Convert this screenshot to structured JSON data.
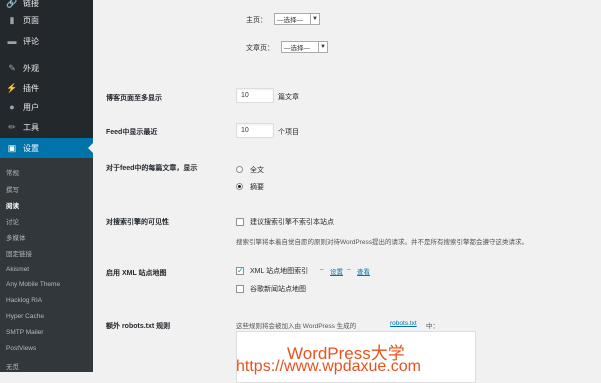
{
  "sidebar": {
    "menu": [
      {
        "icon": "link-icon",
        "glyph": "🔗",
        "label": "链接"
      },
      {
        "icon": "page-icon",
        "glyph": "▮",
        "label": "页面"
      },
      {
        "icon": "comment-icon",
        "glyph": "▬",
        "label": "评论"
      },
      {
        "icon": "appearance-icon",
        "glyph": "✎",
        "label": "外观"
      },
      {
        "icon": "plugin-icon",
        "glyph": "⚡",
        "label": "插件"
      },
      {
        "icon": "user-icon",
        "glyph": "●",
        "label": "用户"
      },
      {
        "icon": "tools-icon",
        "glyph": "✏",
        "label": "工具"
      }
    ],
    "current": {
      "icon": "settings-icon",
      "glyph": "▣",
      "label": "设置"
    },
    "submenu": [
      "常规",
      "撰写",
      "阅读",
      "讨论",
      "多媒体",
      "固定链接",
      "Akismet",
      "Any Mobile Theme",
      "Hacklog RIA",
      "Hyper Cache",
      "SMTP Mailer",
      "PostViews",
      "无觅"
    ]
  },
  "form": {
    "homepage_label": "主页：",
    "homepage_select": "—选择—",
    "postspage_label": "文章页：",
    "postspage_select": "—选择—",
    "posts_per_page_label": "博客页面至多显示",
    "posts_per_page_value": "10",
    "posts_per_page_unit": "篇文章",
    "feed_label": "Feed中显示最近",
    "feed_value": "10",
    "feed_unit": "个项目",
    "feed_article_label": "对于feed中的每篇文章，显示",
    "feed_full": "全文",
    "feed_summary": "摘要",
    "visibility_label": "对搜索引擎的可见性",
    "visibility_checkbox": "建议搜索引擎不索引本站点",
    "visibility_desc": "搜索引擎将本着自觉自愿的原则对待WordPress提出的请求。并不是所有搜索引擎都会遵守这类请求。",
    "xml_label": "启用 XML 站点地图",
    "xml_checkbox": "XML 站点地图索引",
    "xml_sep1": "–",
    "xml_settings": "设置",
    "xml_sep2": "–",
    "xml_view": "查看",
    "google_news": "谷歌新闻站点地图",
    "robots_label": "额外 robots.txt 规则",
    "robots_desc_pre": "这些规则将会被加入由 WordPress 生成的",
    "robots_link": "robots.txt",
    "robots_desc_post": "中："
  },
  "watermark": {
    "line1": "WordPress大学",
    "line2": "https://www.wpdaxue.com"
  }
}
